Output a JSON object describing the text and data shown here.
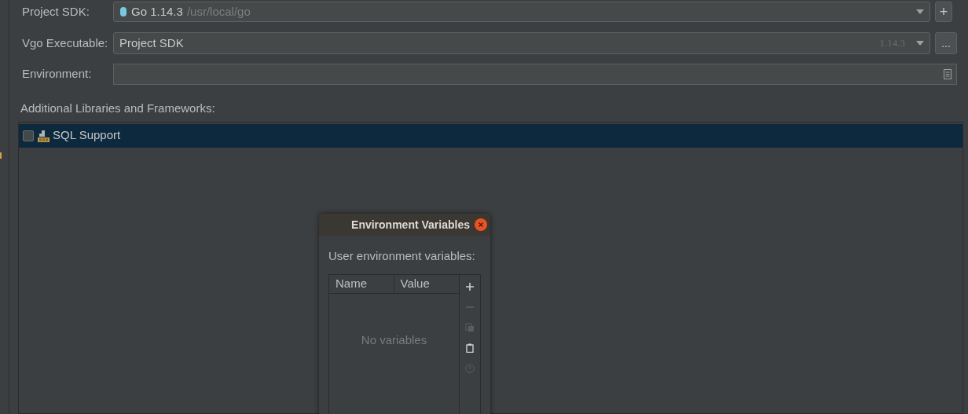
{
  "form": {
    "project_sdk": {
      "label": "Project SDK:",
      "value": "Go 1.14.3",
      "detail": "/usr/local/go",
      "add_button": "+"
    },
    "vgo_executable": {
      "label": "Vgo Executable:",
      "value": "Project SDK",
      "version": "1.14.3",
      "browse_button": "..."
    },
    "environment": {
      "label": "Environment:"
    }
  },
  "libraries": {
    "label": "Additional Libraries and Frameworks:",
    "items": [
      {
        "label": "SQL Support",
        "checked": false,
        "selected": true
      }
    ]
  },
  "dialog": {
    "title": "Environment Variables",
    "subtitle": "User environment variables:",
    "columns": [
      "Name",
      "Value"
    ],
    "empty_text": "No variables",
    "tools": [
      {
        "kind": "add",
        "disabled": false
      },
      {
        "kind": "remove",
        "disabled": true
      },
      {
        "kind": "copy",
        "disabled": true
      },
      {
        "kind": "paste",
        "disabled": false
      },
      {
        "kind": "help",
        "disabled": true
      }
    ]
  }
}
